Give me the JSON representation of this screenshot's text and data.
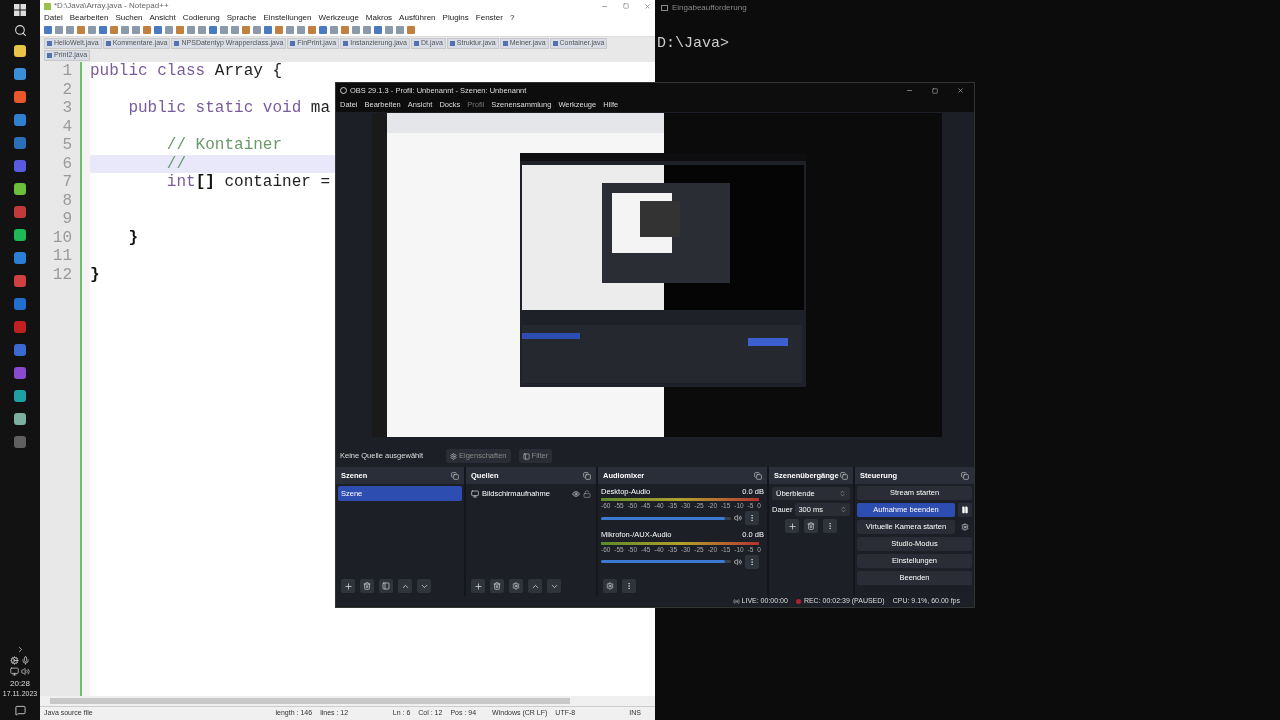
{
  "taskbar": {
    "time": "20:28",
    "date": "17.11.2023",
    "apps": [
      {
        "color": "#e8c44a"
      },
      {
        "color": "#3a8fd8"
      },
      {
        "color": "#e8582a"
      },
      {
        "color": "#2f7fd0"
      },
      {
        "color": "#2a6fb8"
      },
      {
        "color": "#5a5ae0"
      },
      {
        "color": "#6bbf3a"
      },
      {
        "color": "#c03a3a"
      },
      {
        "color": "#1db954"
      },
      {
        "color": "#2b7fd4"
      },
      {
        "color": "#d04040"
      },
      {
        "color": "#2070d0"
      },
      {
        "color": "#c02020"
      },
      {
        "color": "#3a6ad0"
      },
      {
        "color": "#8a4ad0"
      },
      {
        "color": "#20a0a0"
      },
      {
        "color": "#7ab0a0"
      },
      {
        "color": "#606060"
      }
    ]
  },
  "notepad": {
    "title": "*D:\\Java\\Array.java - Notepad++",
    "menu": [
      "Datei",
      "Bearbeiten",
      "Suchen",
      "Ansicht",
      "Codierung",
      "Sprache",
      "Einstellungen",
      "Werkzeuge",
      "Makros",
      "Ausführen",
      "Plugins",
      "Fenster",
      "?"
    ],
    "tabs": [
      {
        "label": "HelloWelt.java",
        "selected": false
      },
      {
        "label": "Kommentare.java",
        "selected": false
      },
      {
        "label": "NPSDatentyp Wrapperclass.java",
        "selected": false
      },
      {
        "label": "FinPrint.java",
        "selected": false
      },
      {
        "label": "Instanzierung.java",
        "selected": false
      },
      {
        "label": "Dt.java",
        "selected": false
      },
      {
        "label": "Struktur.java",
        "selected": false
      },
      {
        "label": "Meiner.java",
        "selected": false
      },
      {
        "label": "Container.java",
        "selected": false
      },
      {
        "label": "Print2.java",
        "selected": false
      }
    ],
    "lines": [
      {
        "number": "1",
        "current": false,
        "segments": [
          {
            "text": "public class",
            "kind": "keyword"
          },
          {
            "text": " Array {",
            "kind": "plain"
          }
        ]
      },
      {
        "number": "2",
        "current": false
      },
      {
        "number": "3",
        "current": false,
        "segments": [
          {
            "text": "    public static void",
            "kind": "keyword"
          },
          {
            "text": " ma",
            "kind": "plain"
          }
        ]
      },
      {
        "number": "4",
        "current": false
      },
      {
        "number": "5",
        "current": false,
        "segments": [
          {
            "text": "        // Kontainer",
            "kind": "comment"
          }
        ]
      },
      {
        "number": "6",
        "current": true,
        "segments": [
          {
            "text": "        //",
            "kind": "comment"
          }
        ]
      },
      {
        "number": "7",
        "current": false,
        "segments": [
          {
            "text": "        int",
            "kind": "keyword"
          },
          {
            "text": "[]",
            "kind": "bracket"
          },
          {
            "text": " container =",
            "kind": "plain"
          }
        ]
      },
      {
        "number": "8",
        "current": false
      },
      {
        "number": "9",
        "current": false
      },
      {
        "number": "10",
        "current": false,
        "segments": [
          {
            "text": "    }",
            "kind": "bracket"
          }
        ]
      },
      {
        "number": "11",
        "current": false
      },
      {
        "number": "12",
        "current": false,
        "segments": [
          {
            "text": "}",
            "kind": "bracket"
          }
        ]
      }
    ],
    "status": {
      "file_type": "Java source file",
      "length": "length : 146",
      "lines": "lines : 12",
      "ln": "Ln : 6",
      "col": "Col : 12",
      "pos": "Pos : 94",
      "eol": "Windows (CR LF)",
      "encoding": "UTF-8",
      "mode": "INS"
    }
  },
  "cmd": {
    "title": "Eingabeaufforderung",
    "prompt": "D:\\Java>"
  },
  "obs": {
    "title": "OBS 29.1.3 - Profil: Unbenannt - Szenen: Unbenannt",
    "menu": [
      {
        "label": "Datei",
        "disabled": false
      },
      {
        "label": "Bearbeiten",
        "disabled": false
      },
      {
        "label": "Ansicht",
        "disabled": false
      },
      {
        "label": "Docks",
        "disabled": false
      },
      {
        "label": "Profil",
        "disabled": true
      },
      {
        "label": "Szenensammlung",
        "disabled": false
      },
      {
        "label": "Werkzeuge",
        "disabled": false
      },
      {
        "label": "Hilfe",
        "disabled": false
      }
    ],
    "source_bar": {
      "label": "Keine Quelle ausgewählt",
      "buttons": [
        {
          "label": "Eigenschaften",
          "kind": "gear",
          "disabled": true
        },
        {
          "label": "Filter",
          "kind": "filter",
          "disabled": true
        }
      ]
    },
    "scenes": {
      "title": "Szenen",
      "items": [
        {
          "label": "Szene",
          "selected": true
        }
      ]
    },
    "sources": {
      "title": "Quellen",
      "items": [
        {
          "label": "Bildschirmaufnahme",
          "visible": true,
          "locked": false
        }
      ]
    },
    "mixer": {
      "title": "Audiomixer",
      "channels": [
        {
          "name": "Desktop-Audio",
          "reading": "0.0 dB",
          "level": 0.95,
          "muted": false,
          "scale": [
            "-60",
            "-55",
            "-50",
            "-45",
            "-40",
            "-35",
            "-30",
            "-25",
            "-20",
            "-15",
            "-10",
            "-5",
            "0"
          ]
        },
        {
          "name": "Mikrofon-/AUX-Audio",
          "reading": "0.0 dB",
          "level": 0.95,
          "muted": false,
          "scale": [
            "-60",
            "-55",
            "-50",
            "-45",
            "-40",
            "-35",
            "-30",
            "-25",
            "-20",
            "-15",
            "-10",
            "-5",
            "0"
          ]
        }
      ]
    },
    "transitions": {
      "title": "Szenenübergänge",
      "transition": "Überblende",
      "duration_label": "Dauer",
      "duration": "300 ms"
    },
    "controls": {
      "title": "Steuerung",
      "buttons": [
        {
          "label": "Stream starten",
          "selected": false,
          "kind": "plain"
        },
        {
          "label": "Aufnahme beenden",
          "selected": true,
          "kind": "pause"
        },
        {
          "label": "Virtuelle Kamera starten",
          "selected": false,
          "kind": "gear"
        },
        {
          "label": "Studio-Modus",
          "selected": false,
          "kind": "plain"
        },
        {
          "label": "Einstellungen",
          "selected": false,
          "kind": "plain"
        },
        {
          "label": "Beenden",
          "selected": false,
          "kind": "plain"
        }
      ]
    },
    "status": {
      "live": "LIVE: 00:00:00",
      "rec": "REC: 00:02:39 (PAUSED)",
      "cpu": "CPU: 9.1%, 60.00 fps"
    }
  }
}
